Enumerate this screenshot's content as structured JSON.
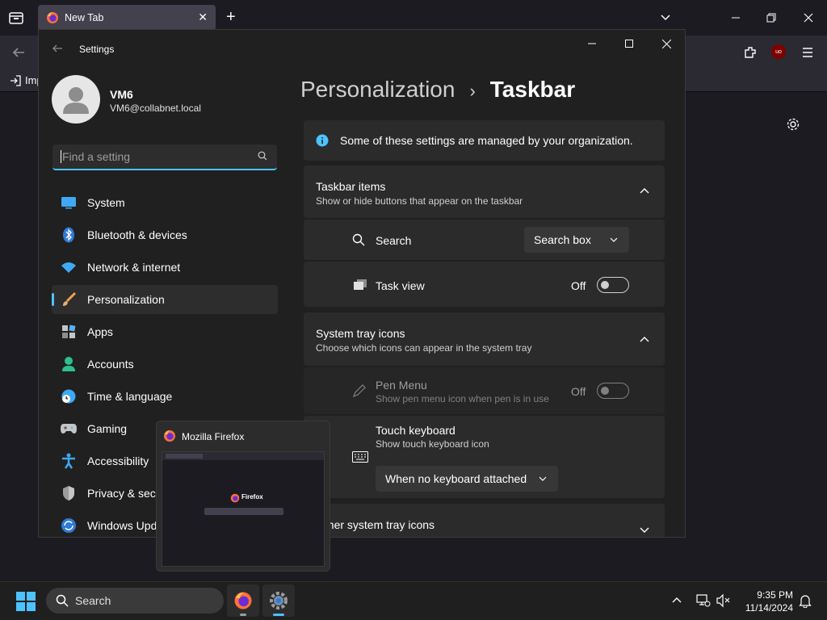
{
  "browser": {
    "tab_title": "New Tab",
    "bookmark_label": "Imp"
  },
  "settings": {
    "window_title": "Settings",
    "user_name": "VM6",
    "user_email": "VM6@collabnet.local",
    "search_placeholder": "Find a setting",
    "breadcrumb_parent": "Personalization",
    "breadcrumb_sep": "›",
    "page_title": "Taskbar",
    "nav": [
      {
        "label": "System"
      },
      {
        "label": "Bluetooth & devices"
      },
      {
        "label": "Network & internet"
      },
      {
        "label": "Personalization"
      },
      {
        "label": "Apps"
      },
      {
        "label": "Accounts"
      },
      {
        "label": "Time & language"
      },
      {
        "label": "Gaming"
      },
      {
        "label": "Accessibility"
      },
      {
        "label": "Privacy & security"
      },
      {
        "label": "Windows Update"
      }
    ],
    "info_banner": "Some of these settings are managed by your organization.",
    "taskbar_items": {
      "title": "Taskbar items",
      "subtitle": "Show or hide buttons that appear on the taskbar",
      "search_label": "Search",
      "search_value": "Search box",
      "taskview_label": "Task view",
      "taskview_state": "Off"
    },
    "tray_icons": {
      "title": "System tray icons",
      "subtitle": "Choose which icons can appear in the system tray",
      "pen_title": "Pen Menu",
      "pen_sub": "Show pen menu icon when pen is in use",
      "pen_state": "Off",
      "touch_title": "Touch keyboard",
      "touch_sub": "Show touch keyboard icon",
      "touch_value": "When no keyboard attached"
    },
    "other_tray": {
      "title": "Other system tray icons"
    }
  },
  "preview": {
    "title": "Mozilla Firefox",
    "thumb_brand": "Firefox"
  },
  "taskbar": {
    "search_label": "Search",
    "time": "9:35 PM",
    "date": "11/14/2024"
  },
  "colors": {
    "accent": "#4cc2ff",
    "ublock": "#800000"
  }
}
